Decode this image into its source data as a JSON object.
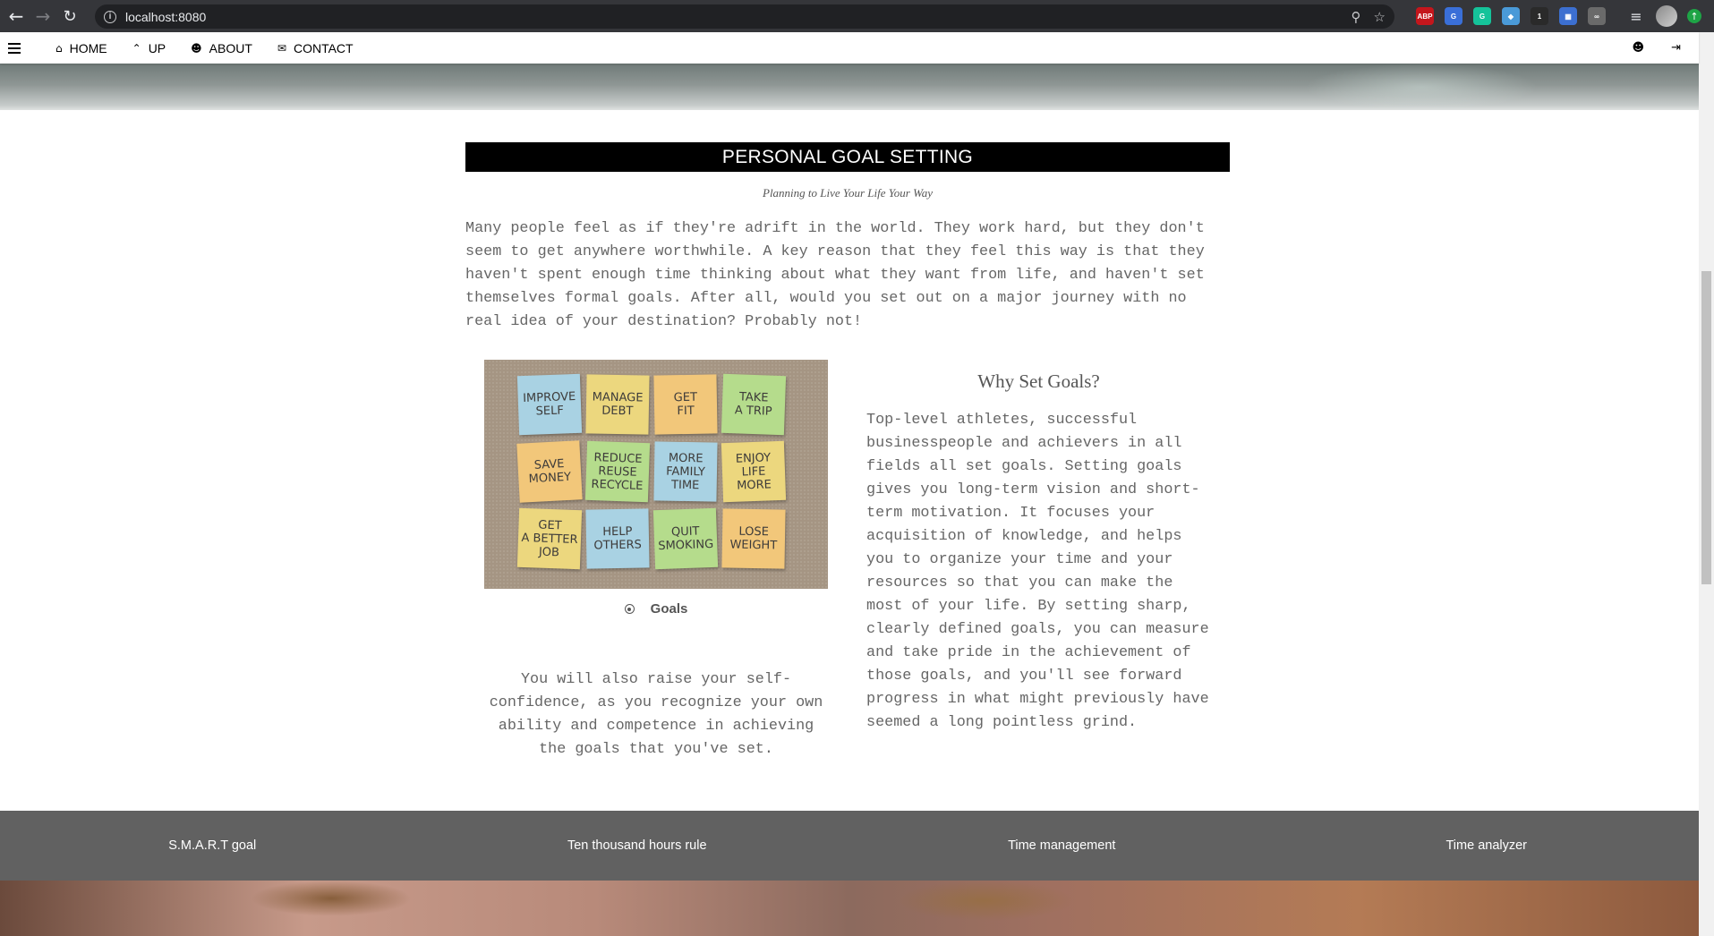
{
  "browser": {
    "url": "localhost:8080",
    "back_icon": "back-arrow-icon",
    "forward_icon": "forward-arrow-icon",
    "reload_icon": "reload-icon",
    "extensions": [
      {
        "name": "abp-extension-icon",
        "label": "ABP",
        "color": "#c4161c"
      },
      {
        "name": "translate-extension-icon",
        "label": "G",
        "color": "#3a6fd8"
      },
      {
        "name": "grammarly-extension-icon",
        "label": "G",
        "color": "#15c39a"
      },
      {
        "name": "shield-extension-icon",
        "label": "◆",
        "color": "#4a9ad8"
      },
      {
        "name": "badge-extension-icon",
        "label": "1",
        "color": "#2a2a2a"
      },
      {
        "name": "grid-extension-icon",
        "label": "▦",
        "color": "#3c6fd0"
      },
      {
        "name": "glasses-extension-icon",
        "label": "∞",
        "color": "#6a6a6a"
      }
    ]
  },
  "nav": {
    "items": [
      {
        "label": "HOME",
        "icon": "⌂"
      },
      {
        "label": "UP",
        "icon": "⌃"
      },
      {
        "label": "ABOUT",
        "icon": "☻"
      },
      {
        "label": "CONTACT",
        "icon": "✉"
      }
    ],
    "user_icon": "☻",
    "login_icon": "⇥"
  },
  "article": {
    "title": "PERSONAL GOAL SETTING",
    "subtitle": "Planning to Live Your Life Your Way",
    "intro": "Many people feel as if they're adrift in the world. They work hard, but they don't seem to get anywhere worthwhile. A key reason that they feel this way is that they haven't spent enough time thinking about what they want from life, and haven't set themselves formal goals. After all, would you set out on a major journey with no real idea of your destination? Probably not!",
    "image_notes": [
      {
        "text": "IMPROVE\nSELF",
        "color": "#a9d2e3"
      },
      {
        "text": "MANAGE\nDEBT",
        "color": "#ecd77e"
      },
      {
        "text": "GET\nFIT",
        "color": "#f2c77a"
      },
      {
        "text": "TAKE\nA TRIP",
        "color": "#b5dc8c"
      },
      {
        "text": "SAVE\nMONEY",
        "color": "#f2c77a"
      },
      {
        "text": "REDUCE\nREUSE\nRECYCLE",
        "color": "#b5dc8c"
      },
      {
        "text": "MORE\nFAMILY\nTIME",
        "color": "#a9d2e3"
      },
      {
        "text": "ENJOY\nLIFE\nMORE",
        "color": "#ecd77e"
      },
      {
        "text": "GET\nA BETTER\nJOB",
        "color": "#ecd77e"
      },
      {
        "text": "HELP\nOTHERS",
        "color": "#a9d2e3"
      },
      {
        "text": "QUIT\nSMOKING",
        "color": "#b5dc8c"
      },
      {
        "text": "LOSE\nWEIGHT",
        "color": "#f2c77a"
      }
    ],
    "image_caption": "Goals",
    "left_text": "You will also raise your self-confidence, as you recognize your own ability and competence in achieving the goals that you've set.",
    "why_title": "Why Set Goals?",
    "why_text": "Top-level athletes, successful businesspeople and achievers in all fields all set goals. Setting goals gives you long-term vision and short-term motivation. It focuses your acquisition of knowledge, and helps you to organize your time and your resources so that you can make the most of your life. By setting sharp, clearly defined goals, you can measure and take pride in the achievement of those goals, and you'll see forward progress in what might previously have seemed a long pointless grind."
  },
  "footer": {
    "links": [
      "S.M.A.R.T goal",
      "Ten thousand hours rule",
      "Time management",
      "Time analyzer"
    ]
  }
}
